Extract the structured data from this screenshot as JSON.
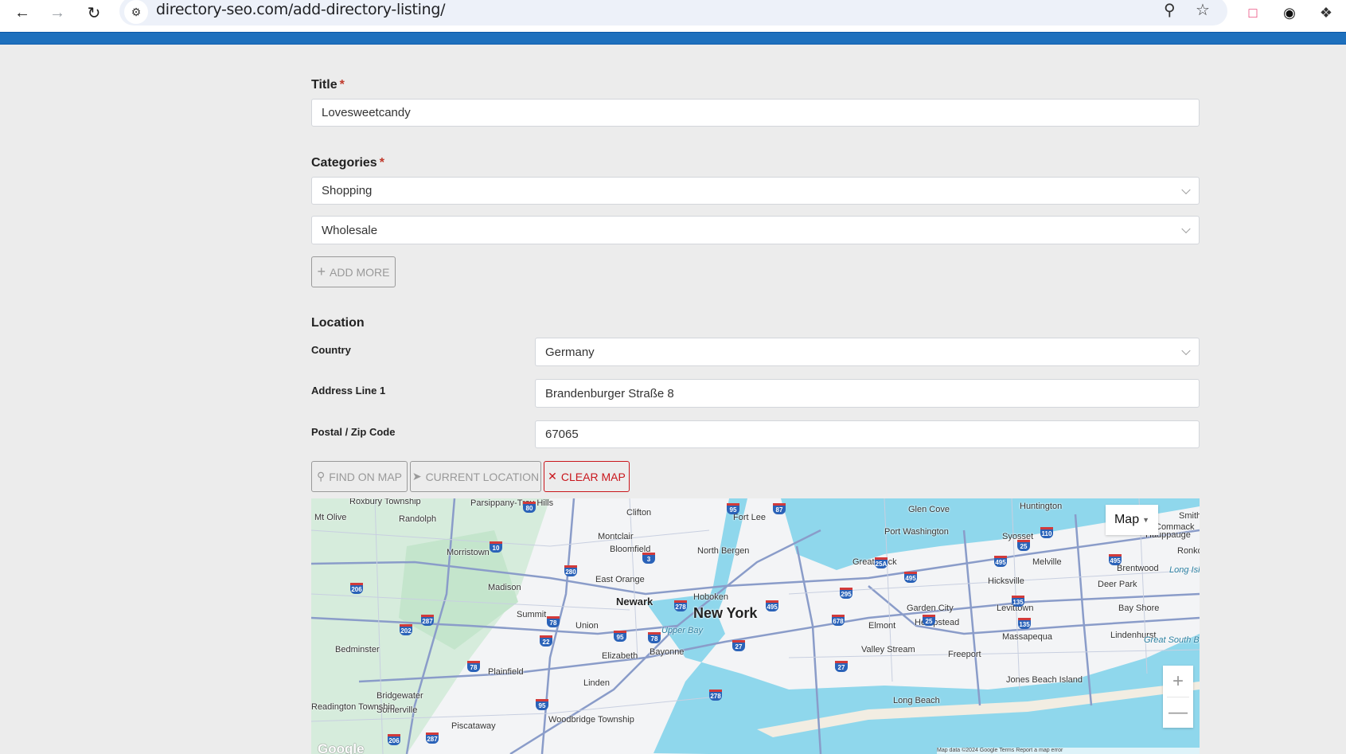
{
  "browser": {
    "url": "directory-seo.com/add-directory-listing/",
    "icons": [
      "back-arrow-icon",
      "forward-arrow-icon",
      "reload-icon",
      "site-info-icon",
      "zoom-out-icon",
      "bookmark-star-icon",
      "feedback-extension-icon",
      "w-extension-icon",
      "extensions-puzzle-icon"
    ]
  },
  "theme": {
    "accent": "#1e70bd",
    "danger": "#c9161c",
    "required": "#c0392b"
  },
  "form": {
    "title": {
      "label": "Title",
      "required_mark": "*",
      "value": "Lovesweetcandy"
    },
    "categories": {
      "label": "Categories",
      "required_mark": "*",
      "selects": [
        "Shopping",
        "Wholesale"
      ],
      "add_more_label": "ADD MORE",
      "add_more_icon": "plus-icon"
    },
    "location": {
      "heading": "Location",
      "country": {
        "label": "Country",
        "value": "Germany"
      },
      "address1": {
        "label": "Address Line 1",
        "value": "Brandenburger Straße 8"
      },
      "zip": {
        "label": "Postal / Zip Code",
        "value": "67065"
      }
    },
    "buttons": {
      "find_on_map": "FIND ON MAP",
      "current_location": "CURRENT LOCATION",
      "clear_map": "CLEAR MAP"
    }
  },
  "map": {
    "type_control": "Map",
    "zoom_in": "+",
    "zoom_out": "—",
    "logo": "Google",
    "attribution": "Map data ©2024 Google   Terms   Report a map error",
    "labels": [
      "Roxbury Township",
      "Mt Olive",
      "Randolph",
      "Parsippany-Troy Hills",
      "Clifton",
      "Fort Lee",
      "Glen Cove",
      "Huntington",
      "Morristown",
      "Montclair",
      "Bloomfield",
      "North Bergen",
      "Port Washington",
      "Great Neck",
      "Syosset",
      "Melville",
      "Hauppauge",
      "Brentwood",
      "East Orange",
      "Madison",
      "Hoboken",
      "Hicksville",
      "Deer Park",
      "Newark",
      "New York",
      "Summit",
      "Union",
      "Garden City",
      "Levittown",
      "Bay Shore",
      "Hempstead",
      "Elmont",
      "Massapequa",
      "Lindenhurst",
      "Bedminster",
      "Elizabeth",
      "Bayonne",
      "Valley Stream",
      "Freeport",
      "Plainfield",
      "Linden",
      "Jones Beach Island",
      "Bridgewater",
      "Somerville",
      "Long Beach",
      "Readington Township",
      "Woodbridge Township",
      "Piscataway",
      "Upper Bay",
      "Great South Bay",
      "Long Island",
      "Smithtown",
      "Commack",
      "Ronkonkoma"
    ],
    "shields": [
      "80",
      "95",
      "87",
      "10",
      "280",
      "3",
      "206",
      "287",
      "202",
      "78",
      "22",
      "95",
      "78",
      "278",
      "495",
      "295",
      "495",
      "25A",
      "495",
      "495",
      "25",
      "678",
      "135",
      "135",
      "27",
      "27",
      "78",
      "278",
      "95",
      "287",
      "206",
      "110",
      "25"
    ]
  }
}
